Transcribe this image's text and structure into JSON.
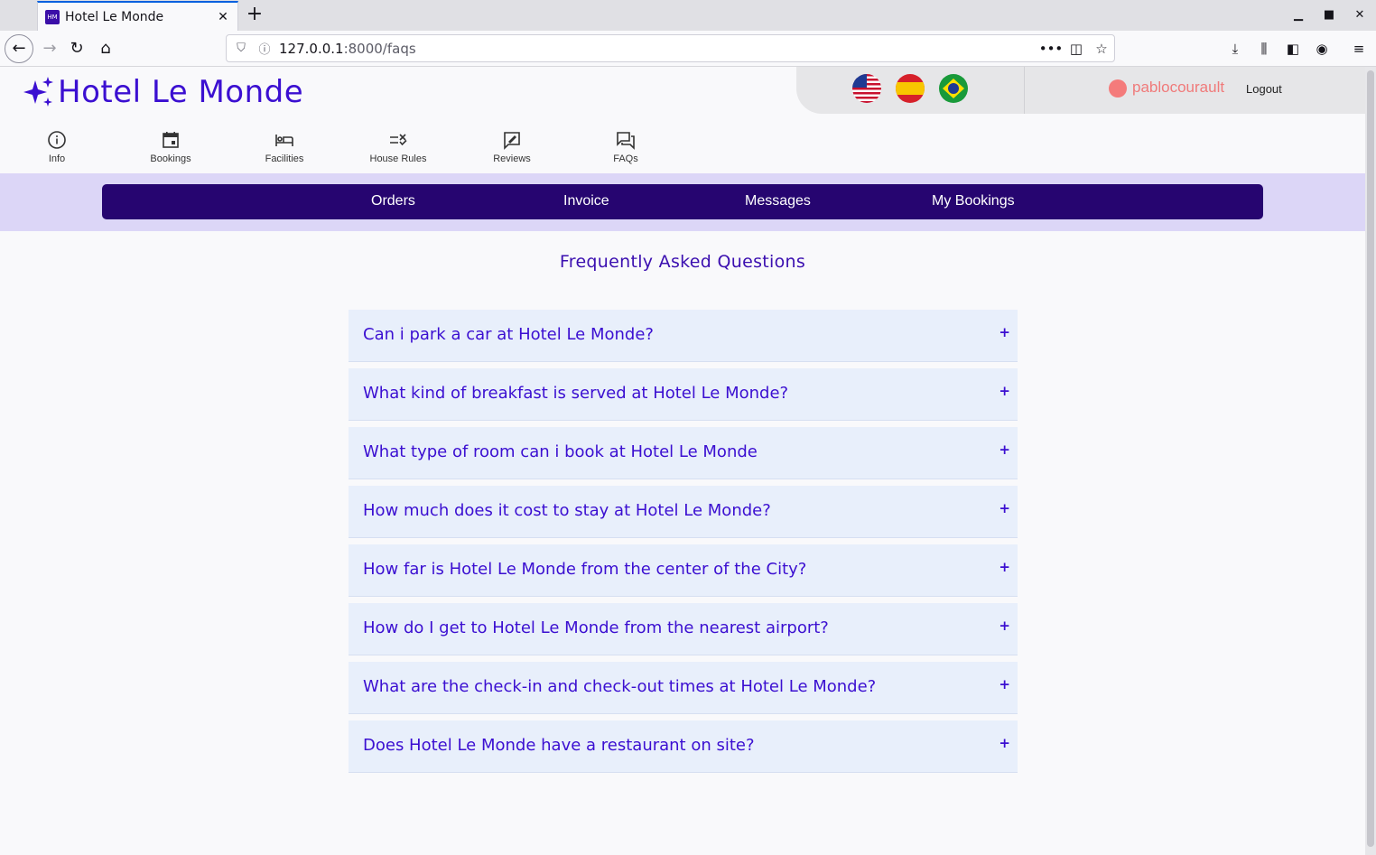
{
  "browser": {
    "tab_title": "Hotel Le Monde",
    "tab_favicon": "HM",
    "url_host": "127.0.0.1",
    "url_path": ":8000/faqs"
  },
  "header": {
    "brand": "Hotel Le Monde",
    "languages": [
      "us-flag",
      "es-flag",
      "br-flag"
    ],
    "username": "pablocourault",
    "logout": "Logout"
  },
  "icon_nav": [
    {
      "label": "Info",
      "icon": "info-icon"
    },
    {
      "label": "Bookings",
      "icon": "calendar-icon"
    },
    {
      "label": "Facilities",
      "icon": "bed-icon"
    },
    {
      "label": "House Rules",
      "icon": "rules-icon"
    },
    {
      "label": "Reviews",
      "icon": "review-icon"
    },
    {
      "label": "FAQs",
      "icon": "chat-icon"
    }
  ],
  "menu": [
    "Orders",
    "Invoice",
    "Messages",
    "My Bookings"
  ],
  "faq": {
    "title": "Frequently Asked Questions",
    "expand_symbol": "+",
    "questions": [
      "Can i park a car at Hotel Le Monde?",
      "What kind of breakfast is served at Hotel Le Monde?",
      "What type of room can i book at Hotel Le Monde",
      "How much does it cost to stay at Hotel Le Monde?",
      "How far is Hotel Le Monde from the center of the City?",
      "How do I get to Hotel Le Monde from the nearest airport?",
      "What are the check-in and check-out times at Hotel Le Monde?",
      "Does Hotel Le Monde have a restaurant on site?"
    ]
  },
  "colors": {
    "brand": "#3b0fd1",
    "menu_bg": "#260570",
    "band_bg": "#dcd6f7",
    "faq_bg": "#e8effb",
    "user": "#f07a7a"
  }
}
